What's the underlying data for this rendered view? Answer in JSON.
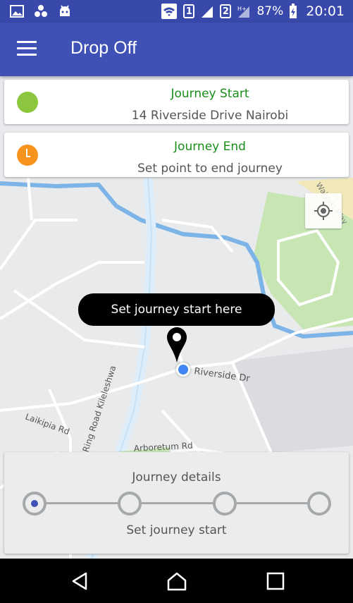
{
  "status_bar": {
    "sim1": "1",
    "sim2": "2",
    "battery": "87%",
    "time": "20:01",
    "icons": [
      "gallery-icon",
      "connections-icon",
      "android-icon",
      "wifi-icon",
      "signal-icon",
      "data-icon",
      "battery-icon"
    ]
  },
  "app_bar": {
    "title": "Drop Off",
    "menu_icon": "menu-icon"
  },
  "journey_start": {
    "title": "Journey Start",
    "address": "14 Riverside Drive Nairobi",
    "color": "#8cc63f"
  },
  "journey_end": {
    "title": "Journey End",
    "address": "Set point to end journey",
    "color": "#f7941d"
  },
  "map": {
    "tooltip": "Set journey start here",
    "labels": {
      "riverside": "Riverside Dr",
      "laikipia": "Laikipia Rd",
      "ring_road": "Ring Road Kileleshwa",
      "arboretum": "Arboretum Rd",
      "waiyaki": "Waiyaki Way"
    }
  },
  "journey_details": {
    "title": "Journey details",
    "subtitle": "Set journey start",
    "steps_total": 4,
    "active_step": 1
  },
  "nav_bar": {
    "buttons": [
      "back-icon",
      "home-icon",
      "recents-icon"
    ]
  },
  "colors": {
    "primary": "#3f51b5",
    "status_bar": "#3949ab",
    "accent_green": "#1b8d1b"
  }
}
